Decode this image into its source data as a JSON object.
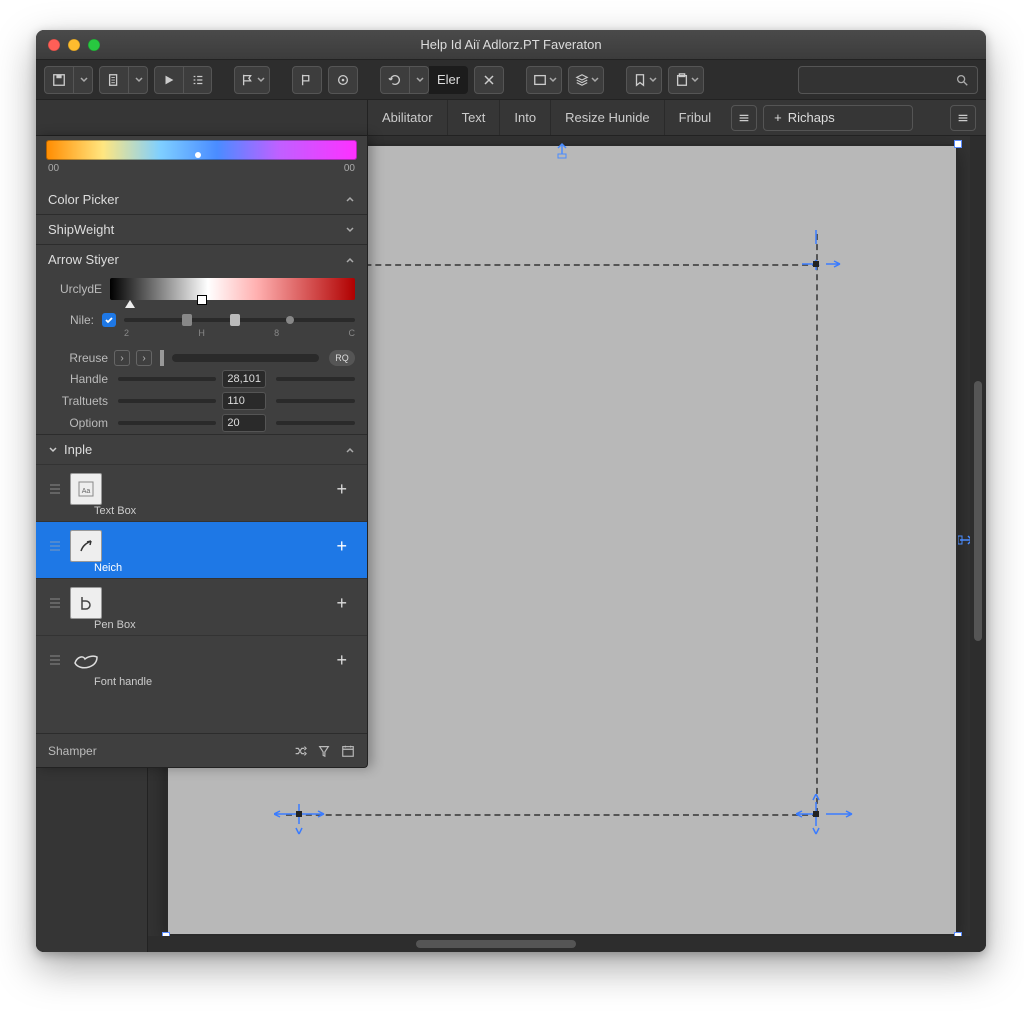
{
  "window": {
    "title": "Help Id Aiï Adlorz.PT Faveraton"
  },
  "spectrum": {
    "left": "00",
    "right": "00",
    "tick_pct": 48
  },
  "sections": {
    "color_picker": "Color Picker",
    "ship_weight": "ShipWeight",
    "arrow_styer": "Arrow Stiyer",
    "urclyde": "UrclydE",
    "nile": "Nile:",
    "nile_ticks": [
      "2",
      "H",
      "8",
      "C"
    ],
    "reuse": "Rreuse",
    "reuse_pill": "RQ",
    "handle": {
      "label": "Handle",
      "value": "28,101"
    },
    "traltuets": {
      "label": "Traltuets",
      "value": "110"
    },
    "optiom": {
      "label": "Optiom",
      "value": "20"
    },
    "inple": "Inple"
  },
  "tabs": [
    "Abilitator",
    "Text",
    "Into",
    "Resize Hunide",
    "Fribul"
  ],
  "richaps": {
    "plus": "+",
    "label": "Richaps"
  },
  "toolbar": {
    "eler": "Eler"
  },
  "layers": [
    {
      "id": "textbox",
      "label": "Text Box",
      "selected": false,
      "icon": "text-icon"
    },
    {
      "id": "neich",
      "label": "Neich",
      "selected": true,
      "icon": "arrow-icon"
    },
    {
      "id": "penbox",
      "label": "Pen Box",
      "selected": false,
      "icon": "pen-icon"
    },
    {
      "id": "fonthandle",
      "label": "Font handle",
      "selected": false,
      "icon": "hand-icon"
    }
  ],
  "shamper": "Shamper"
}
